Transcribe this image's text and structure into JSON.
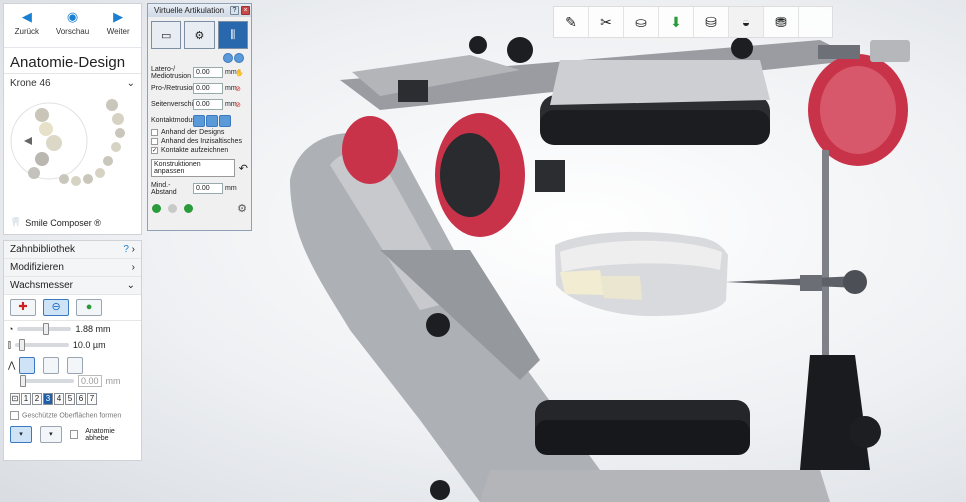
{
  "nav": {
    "back": "Zurück",
    "preview": "Vorschau",
    "next": "Weiter"
  },
  "left": {
    "title": "Anatomie-Design",
    "tooth": "Krone 46",
    "smile_composer": "Smile Composer ®"
  },
  "sub": {
    "rows": [
      {
        "label": "Zahnbibliothek",
        "q": "?"
      },
      {
        "label": "Modifizieren"
      },
      {
        "label": "Wachsmesser"
      }
    ],
    "size_value": "1.88 mm",
    "thickness_value": "10.0 µm",
    "blank_value": "0.00",
    "blank_unit": "mm",
    "num_buttons": [
      "1",
      "2",
      "3",
      "4",
      "5",
      "6",
      "7"
    ],
    "active_num": "3",
    "protected_surfaces": "Geschützte Oberflächen formen",
    "anatomy": "Anatomie abhebe"
  },
  "dialog": {
    "title": "Virtuelle Artikulation",
    "fields": [
      {
        "label": "Latero-/ Mediotrusion",
        "value": "0.00",
        "unit": "mm"
      },
      {
        "label": "Pro-/Retrusion",
        "value": "0.00",
        "unit": "mm"
      },
      {
        "label": "Seitenverschie",
        "value": "0.00",
        "unit": "mm"
      }
    ],
    "contact_mode": "Kontaktmodus",
    "checks": [
      {
        "label": "Anhand der Designs",
        "checked": false
      },
      {
        "label": "Anhand des Inzisaltisches",
        "checked": false
      },
      {
        "label": "Kontakte aufzeichnen",
        "checked": true
      }
    ],
    "construct_button": "Konstruktionen anpassen",
    "min_distance_label": "Mind.-Abstand",
    "min_distance_value": "0.00",
    "min_distance_unit": "mm"
  },
  "toolbar": {
    "icons": [
      "scan-icon",
      "cut-icon",
      "crown-icon",
      "green-arrow-icon",
      "crown-top-icon",
      "crown-white-icon",
      "crown-side-icon"
    ]
  },
  "colors": {
    "accent": "#1a7fd0",
    "articulator_red": "#c8334a",
    "metal": "#8a8d92"
  }
}
